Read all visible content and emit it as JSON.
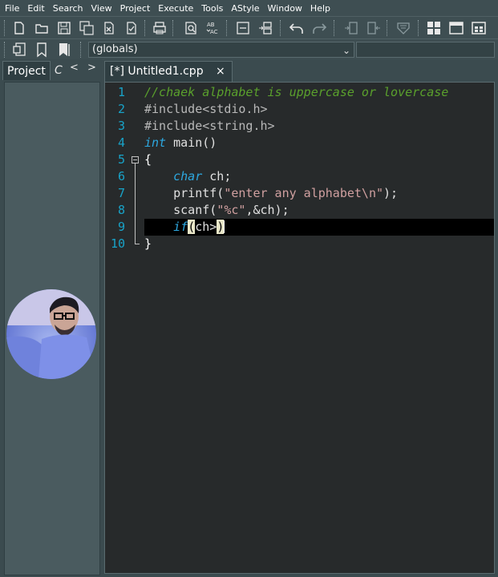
{
  "menu": [
    "File",
    "Edit",
    "Search",
    "View",
    "Project",
    "Execute",
    "Tools",
    "AStyle",
    "Window",
    "Help"
  ],
  "toolbar": {
    "icons": [
      "new-file-icon",
      "open-icon",
      "save-icon",
      "save-all-icon",
      "close-icon",
      "close-all-icon",
      "print-icon",
      "find-icon",
      "replace-icon",
      "goto-line-icon",
      "toggle-icon",
      "undo-icon",
      "redo-icon",
      "indent-icon",
      "unindent-icon",
      "bookmark-icon",
      "layout-icon",
      "window-icon",
      "tile-icon"
    ]
  },
  "toolbar2": {
    "scope_value": "(globals)",
    "icons": [
      "class-icon",
      "bookmark-icon",
      "bookmark-filled-icon"
    ]
  },
  "left_panel": {
    "tab_project": "Project",
    "tab_c": "C",
    "nav_prev": "<",
    "nav_next": ">"
  },
  "editor": {
    "tab_title": "[*] Untitled1.cpp",
    "tab_close": "×",
    "lines": [
      {
        "num": "1",
        "text": "//chaek alphabet is uppercase or lovercase"
      },
      {
        "num": "2",
        "text": "#include<stdio.h>"
      },
      {
        "num": "3",
        "text": "#include<string.h>"
      },
      {
        "num": "4",
        "text": "int main()"
      },
      {
        "num": "5",
        "text": "{"
      },
      {
        "num": "6",
        "text": "    char ch;"
      },
      {
        "num": "7",
        "text": "    printf(\"enter any alphabet\\n\");"
      },
      {
        "num": "8",
        "text": "    scanf(\"%c\",&ch);"
      },
      {
        "num": "9",
        "text": "    if(ch>)"
      },
      {
        "num": "10",
        "text": "}"
      }
    ]
  },
  "colors": {
    "line_number": "#18a3c8",
    "comment": "#5aa02c",
    "keyword": "#2da8e0",
    "editor_bg": "#272a2b",
    "highlight_line": "#000000"
  }
}
